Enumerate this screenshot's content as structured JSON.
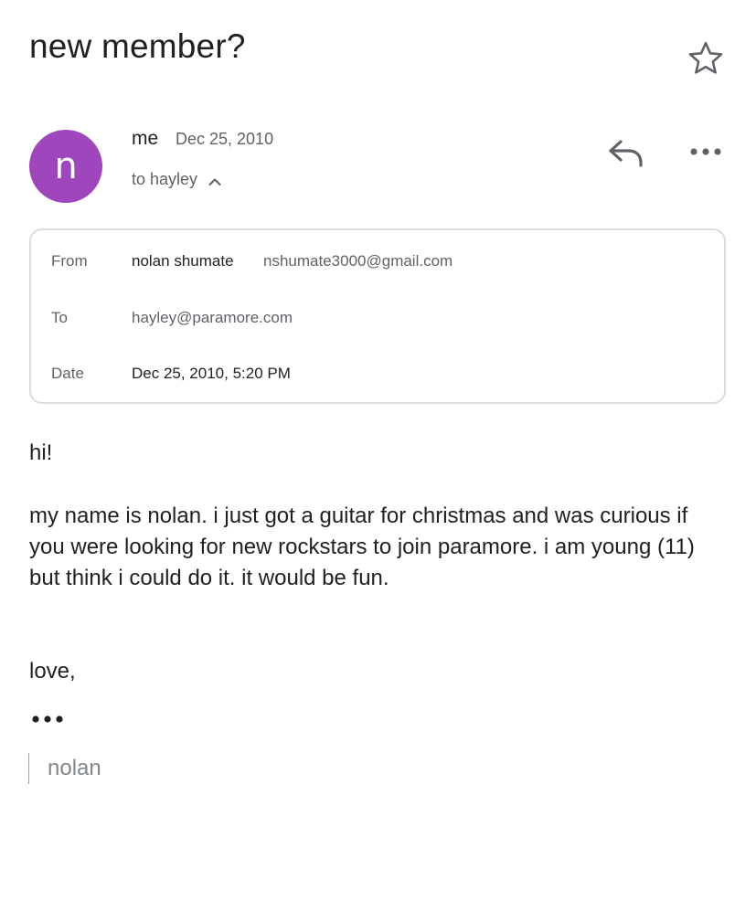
{
  "subject": "new member?",
  "header": {
    "avatar_letter": "n",
    "avatar_color": "#a046bd",
    "sender": "me",
    "date": "Dec 25, 2010",
    "recipients": "to hayley",
    "icons": [
      "star-icon",
      "reply-icon",
      "more-icon",
      "chevron-up-icon"
    ]
  },
  "details": {
    "from_label": "From",
    "from_name": "nolan shumate",
    "from_email": "nshumate3000@gmail.com",
    "to_label": "To",
    "to_value": "hayley@paramore.com",
    "date_label": "Date",
    "date_value": "Dec 25, 2010, 5:20 PM"
  },
  "body": {
    "greeting": "hi!",
    "paragraph": "my name is nolan. i just got a guitar for christmas and was curious if you were looking for new rockstars to join paramore. i am young (11) but think i could do it. it would be fun.",
    "closing": "love,",
    "signature": "nolan"
  }
}
